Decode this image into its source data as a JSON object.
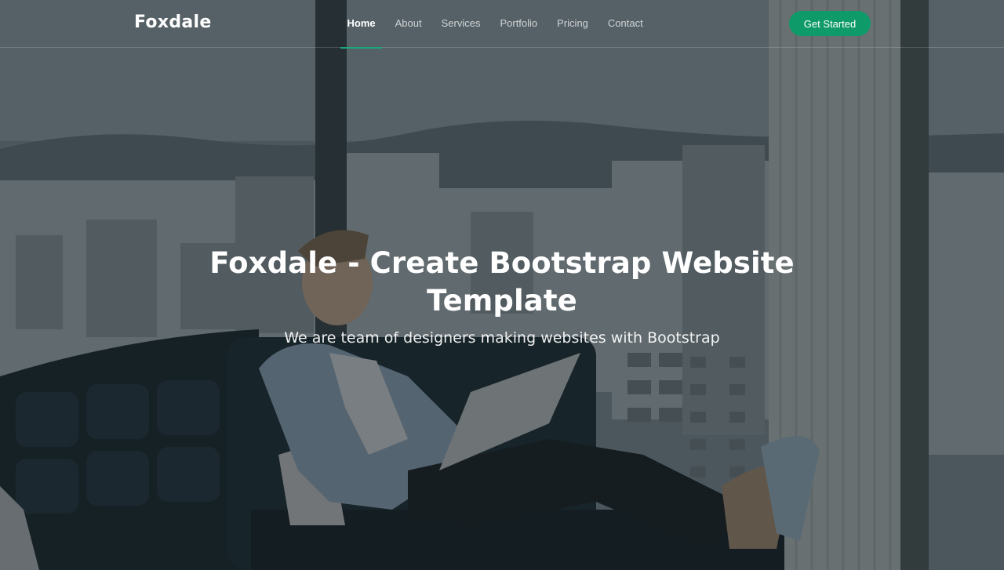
{
  "header": {
    "logo": "Foxdale",
    "nav": [
      {
        "label": "Home",
        "active": true
      },
      {
        "label": "About",
        "active": false
      },
      {
        "label": "Services",
        "active": false
      },
      {
        "label": "Portfolio",
        "active": false
      },
      {
        "label": "Pricing",
        "active": false
      },
      {
        "label": "Contact",
        "active": false
      }
    ],
    "cta_label": "Get Started"
  },
  "hero": {
    "title": "Foxdale - Create Bootstrap Website Template",
    "subtitle": "We are team of designers making websites with Bootstrap"
  },
  "colors": {
    "accent": "#0e9a69",
    "overlay": "#12181c"
  }
}
